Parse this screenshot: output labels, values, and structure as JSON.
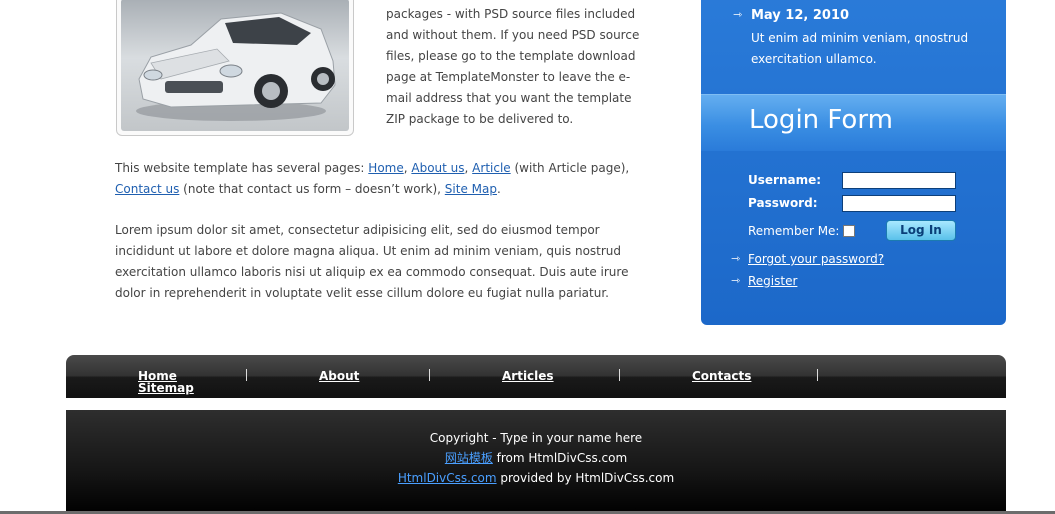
{
  "intro": {
    "text": "packages - with PSD source files included and without them. If you need PSD source files, please go to the template download page at TemplateMonster to leave the e-mail address that you want the template ZIP package to be delivered to."
  },
  "pages": {
    "prefix": "This website template has several pages: ",
    "home": "Home",
    "comma1": ", ",
    "about": "About us",
    "comma2": ", ",
    "article": "Article",
    "mid": " (with Article page), ",
    "contact": "Contact us",
    "note": " (note that contact us form – doesn’t work), ",
    "sitemap": "Site Map",
    "end": "."
  },
  "lorem": "Lorem ipsum dolor sit amet, consectetur adipisicing elit, sed do eiusmod tempor incididunt ut labore et dolore magna aliqua. Ut enim ad minim veniam, quis nostrud exercitation ullamco laboris nisi ut aliquip ex ea commodo consequat. Duis aute irure dolor in reprehenderit in voluptate velit esse cillum dolore eu fugiat nulla pariatur.",
  "news": {
    "date": "May 12, 2010",
    "text": "Ut enim ad minim veniam, qnostrud exercitation ullamco."
  },
  "login": {
    "title": "Login Form",
    "username_label": "Username:",
    "password_label": "Password:",
    "username_value": "",
    "password_value": "",
    "remember_label": "Remember Me:",
    "button_label": "Log In",
    "forgot_link": "Forgot your password?",
    "register_link": "Register"
  },
  "nav": {
    "items": [
      "Home",
      "About",
      "Articles",
      "Contacts",
      "Sitemap"
    ]
  },
  "footer": {
    "copyright": "Copyright - Type in your name here",
    "line2_link": "网站模板",
    "line2_text": " from HtmlDivCss.com",
    "line3_link": "HtmlDivCss.com",
    "line3_text": " provided by HtmlDivCss.com"
  },
  "colors": {
    "panel_blue": "#2a7bd9",
    "link_blue": "#1f5fb0",
    "nav_dark": "#222222"
  }
}
